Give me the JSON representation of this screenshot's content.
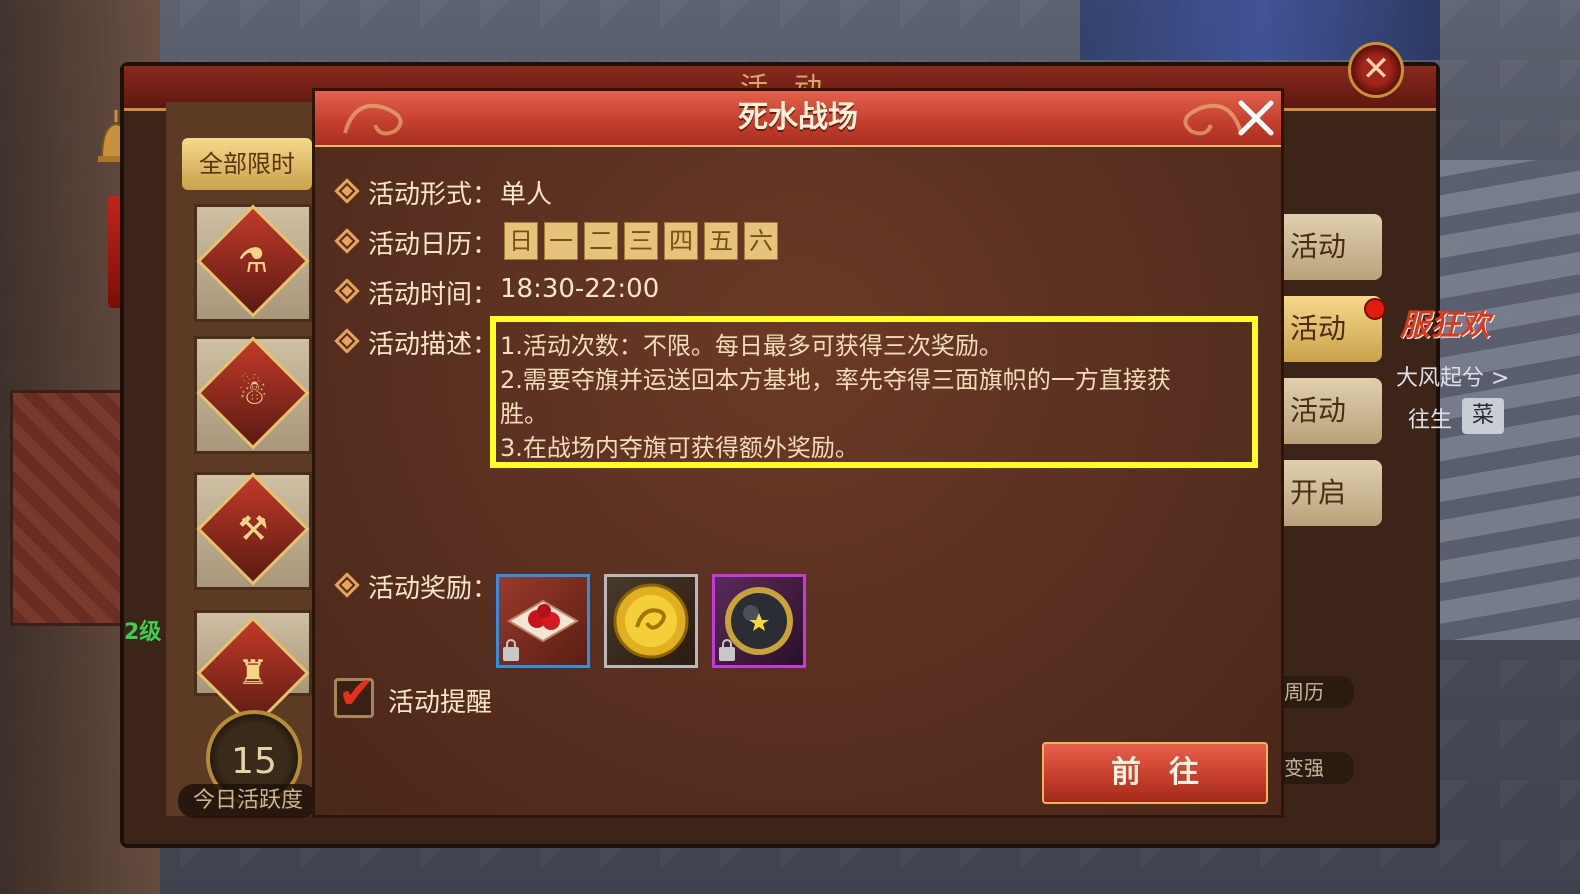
{
  "dialog": {
    "title": "死水战场",
    "rows": {
      "form_label": "活动形式：",
      "form_value": "单人",
      "calendar_label": "活动日历：",
      "calendar_days": [
        "日",
        "一",
        "二",
        "三",
        "四",
        "五",
        "六"
      ],
      "time_label": "活动时间：",
      "time_value": "18:30-22:00",
      "desc_label": "活动描述：",
      "desc_lines": [
        "1.活动次数：不限。每日最多可获得三次奖励。",
        "2.需要夺旗并运送回本方基地，率先夺得三面旗帜的一方直接获",
        "胜。",
        "3.在战场内夺旗可获得额外奖励。"
      ],
      "reward_label": "活动奖励："
    },
    "reminder_label": "活动提醒",
    "go_button": "前往",
    "highlight_color": "#ffff22"
  },
  "background": {
    "panel_title": "活动",
    "filter_button": "全部限时",
    "level_text": "2级",
    "activity_score": "15",
    "activity_score_label": "今日活跃度",
    "right_tabs": [
      "活动",
      "活动",
      "活动",
      "开启"
    ],
    "right_small": [
      "周历",
      "变强"
    ],
    "side_logo": "服狂欢",
    "side_link": "大风起兮 >",
    "side_text": "往生",
    "side_badge": "菜"
  },
  "rewards": [
    {
      "icon": "red-berries-icon",
      "frame": "#2f8fe0",
      "locked": true
    },
    {
      "icon": "gold-coin-icon",
      "frame": "#b9b9b9",
      "locked": false
    },
    {
      "icon": "dark-orb-icon",
      "frame": "#c23bd8",
      "locked": true
    }
  ]
}
